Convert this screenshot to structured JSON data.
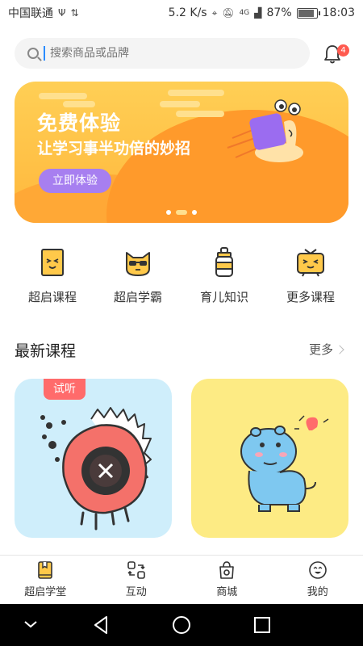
{
  "status_bar": {
    "carrier": "中国联通",
    "speed": "5.2 K/s",
    "network": "4G",
    "battery": "87%",
    "battery_level": 0.87,
    "time": "18:03"
  },
  "search": {
    "placeholder": "搜索商品或品牌"
  },
  "notifications": {
    "count": "4"
  },
  "banner": {
    "title": "免费体验",
    "subtitle": "让学习事半功倍的妙招",
    "button": "立即体验",
    "colors": {
      "background": "#ffc94a",
      "button": "#a77ff0"
    }
  },
  "categories": [
    {
      "label": "超启课程",
      "icon": "book-icon"
    },
    {
      "label": "超启学霸",
      "icon": "cool-cat-icon"
    },
    {
      "label": "育儿知识",
      "icon": "baby-bottle-icon"
    },
    {
      "label": "更多课程",
      "icon": "tv-face-icon"
    }
  ],
  "section": {
    "title": "最新课程",
    "more": "更多"
  },
  "courses": [
    {
      "tag": "试听",
      "illustration": "spiky-fish-illustration",
      "bg": "#cfeefb"
    },
    {
      "tag": "",
      "illustration": "blue-hippo-illustration",
      "bg": "#fdeb84"
    }
  ],
  "tabbar": {
    "items": [
      {
        "label": "超启学堂",
        "icon": "home-book-icon",
        "active": true
      },
      {
        "label": "互动",
        "icon": "interact-icon"
      },
      {
        "label": "商城",
        "icon": "shop-bag-icon"
      },
      {
        "label": "我的",
        "icon": "profile-face-icon"
      }
    ]
  }
}
